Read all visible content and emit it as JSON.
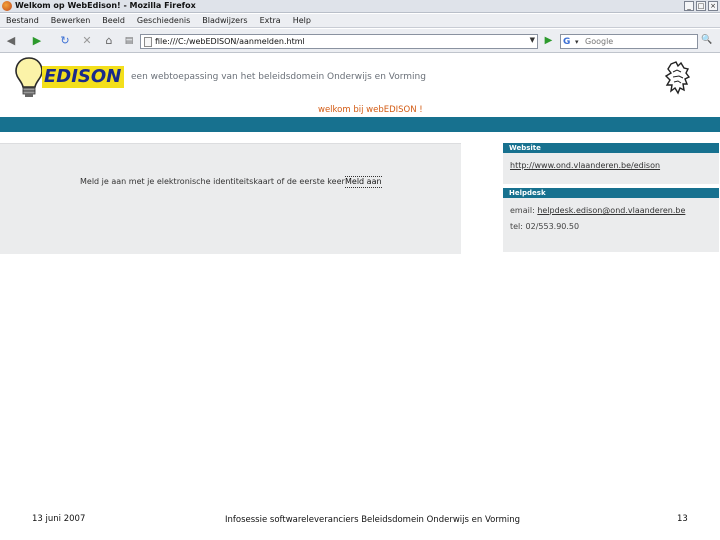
{
  "window": {
    "title": "Welkom op WebEdison! - Mozilla Firefox",
    "minimize": "_",
    "maximize": "□",
    "close": "×"
  },
  "menu": [
    "Bestand",
    "Bewerken",
    "Beeld",
    "Geschiedenis",
    "Bladwijzers",
    "Extra",
    "Help"
  ],
  "toolbar": {
    "back": "◀",
    "forward": "▶",
    "reload": "↻",
    "stop": "✕",
    "home": "⌂",
    "url": "file:///C:/webEDISON/aanmelden.html",
    "go": "▶",
    "search_engine": "G",
    "search_placeholder": "Google"
  },
  "header": {
    "logo": "EDISON",
    "tagline": "een webtoepassing van het beleidsdomein Onderwijs en Vorming",
    "welcome": "welkom bij webEDISON !"
  },
  "main": {
    "message": "Meld je aan met je elektronische identiteitskaart of de eerste keer",
    "login_link": "Meld aan"
  },
  "sidebar": {
    "website_title": "Website",
    "website_url": "http://www.ond.vlaanderen.be/edison",
    "helpdesk_title": "Helpdesk",
    "email_label": "email:",
    "email": "helpdesk.edison@ond.vlaanderen.be",
    "tel": "tel: 02/553.90.50"
  },
  "footer": {
    "date": "13 juni 2007",
    "center": "Infosessie softwareleveranciers Beleidsdomein Onderwijs en Vorming",
    "page": "13"
  },
  "colors": {
    "band": "#17718f",
    "logo_bg": "#f3df1c",
    "logo_text": "#1a2a8a",
    "welcome": "#d35b13",
    "panel": "#ebeced"
  }
}
